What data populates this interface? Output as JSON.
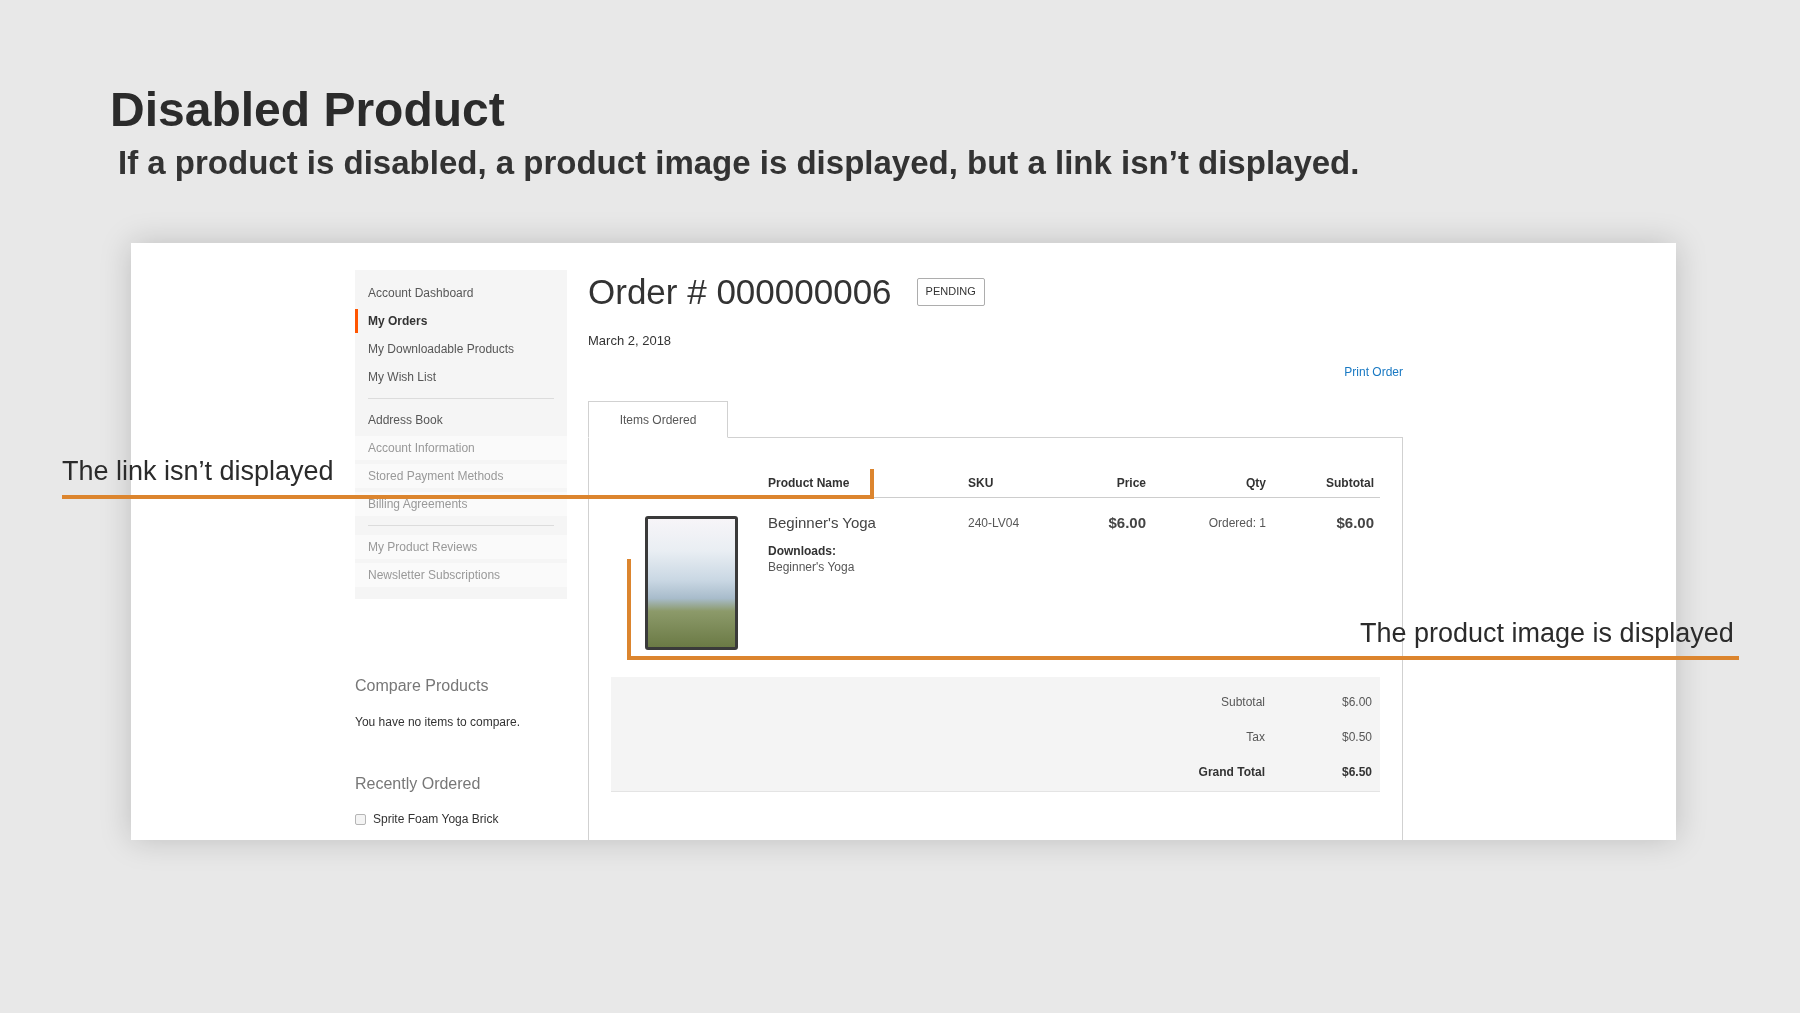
{
  "heading": {
    "title": "Disabled Product",
    "subtitle": "If a product is disabled, a product image is displayed, but a link isn’t displayed."
  },
  "sidebar": {
    "groups": [
      {
        "items": [
          {
            "label": "Account Dashboard",
            "selected": false,
            "dimmed": false
          },
          {
            "label": "My Orders",
            "selected": true,
            "dimmed": false
          },
          {
            "label": "My Downloadable Products",
            "selected": false,
            "dimmed": false
          },
          {
            "label": "My Wish List",
            "selected": false,
            "dimmed": false
          }
        ]
      },
      {
        "items": [
          {
            "label": "Address Book",
            "selected": false,
            "dimmed": false
          },
          {
            "label": "Account Information",
            "selected": false,
            "dimmed": true
          },
          {
            "label": "Stored Payment Methods",
            "selected": false,
            "dimmed": true
          },
          {
            "label": "Billing Agreements",
            "selected": false,
            "dimmed": true
          }
        ]
      },
      {
        "items": [
          {
            "label": "My Product Reviews",
            "selected": false,
            "dimmed": true
          },
          {
            "label": "Newsletter Subscriptions",
            "selected": false,
            "dimmed": true
          }
        ]
      }
    ]
  },
  "compare": {
    "title": "Compare Products",
    "message": "You have no items to compare."
  },
  "recently_ordered": {
    "title": "Recently Ordered",
    "items": [
      {
        "label": "Sprite Foam Yoga Brick",
        "checked": false
      }
    ]
  },
  "order": {
    "title": "Order # 000000006",
    "status": "PENDING",
    "date": "March 2, 2018",
    "print_link": "Print Order",
    "tabs": [
      {
        "label": "Items Ordered",
        "selected": true
      }
    ],
    "table": {
      "columns": [
        "Product Name",
        "SKU",
        "Price",
        "Qty",
        "Subtotal"
      ],
      "rows": [
        {
          "product_name": "Beginner's Yoga",
          "downloads_label": "Downloads:",
          "downloads": "Beginner's Yoga",
          "sku": "240-LV04",
          "price": "$6.00",
          "qty": "Ordered: 1",
          "subtotal": "$6.00"
        }
      ]
    },
    "totals": [
      {
        "label": "Subtotal",
        "value": "$6.00",
        "kind": "normal"
      },
      {
        "label": "Tax",
        "value": "$0.50",
        "kind": "normal"
      },
      {
        "label": "Grand Total",
        "value": "$6.50",
        "kind": "grand"
      }
    ]
  },
  "annotations": [
    {
      "text": "The link isn’t displayed"
    },
    {
      "text": "The product image is displayed"
    }
  ]
}
